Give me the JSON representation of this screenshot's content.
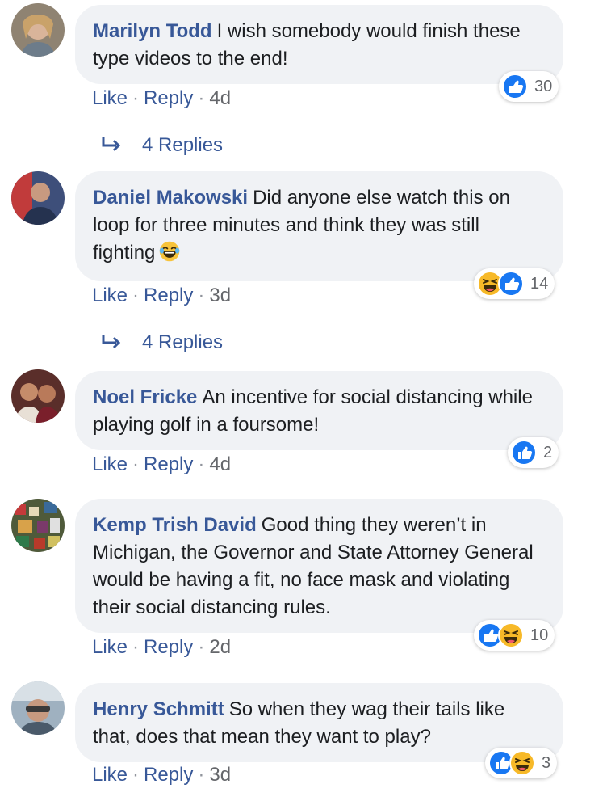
{
  "colors": {
    "link": "#385898",
    "bubble": "#f0f2f5",
    "like_blue": "#1877f2",
    "haha_yellow": "#f7b928"
  },
  "comments": [
    {
      "author": "Marilyn Todd",
      "text": "I wish somebody would finish these type videos to the end!",
      "like_label": "Like",
      "reply_label": "Reply",
      "time": "4d",
      "reaction_icons": [
        "like-icon"
      ],
      "reaction_count": "30",
      "replies_label": "4 Replies"
    },
    {
      "author": "Daniel Makowski",
      "text": "Did anyone else watch this on loop for three minutes and think they was still fighting",
      "inline_emoji": "laughing-face-icon",
      "like_label": "Like",
      "reply_label": "Reply",
      "time": "3d",
      "reaction_icons": [
        "haha-icon",
        "like-icon"
      ],
      "reaction_count": "14",
      "replies_label": "4 Replies"
    },
    {
      "author": "Noel Fricke",
      "text": "An incentive for social distancing while playing golf in a foursome!",
      "like_label": "Like",
      "reply_label": "Reply",
      "time": "4d",
      "reaction_icons": [
        "like-icon"
      ],
      "reaction_count": "2"
    },
    {
      "author": "Kemp Trish David",
      "text": "Good thing they weren’t in Michigan, the Governor and State Attorney General would be having a fit, no face mask and violating their social distancing rules.",
      "like_label": "Like",
      "reply_label": "Reply",
      "time": "2d",
      "reaction_icons": [
        "like-icon",
        "haha-icon"
      ],
      "reaction_count": "10"
    },
    {
      "author": "Henry Schmitt",
      "text": "So when they wag their tails like that, does that mean they want to play?",
      "like_label": "Like",
      "reply_label": "Reply",
      "time": "3d",
      "reaction_icons": [
        "like-icon",
        "haha-icon"
      ],
      "reaction_count": "3"
    }
  ],
  "separator": "·"
}
